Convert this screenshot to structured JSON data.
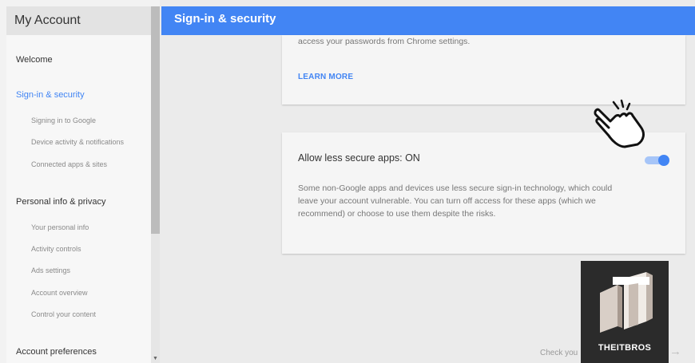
{
  "sidebar": {
    "title": "My Account",
    "items": [
      {
        "label": "Welcome"
      },
      {
        "label": "Sign-in & security",
        "active": true
      },
      {
        "label": "Signing in to Google"
      },
      {
        "label": "Device activity & notifications"
      },
      {
        "label": "Connected apps & sites"
      },
      {
        "label": "Personal info & privacy"
      },
      {
        "label": "Your personal info"
      },
      {
        "label": "Activity controls"
      },
      {
        "label": "Ads settings"
      },
      {
        "label": "Account overview"
      },
      {
        "label": "Control your content"
      },
      {
        "label": "Account preferences"
      }
    ]
  },
  "header": {
    "title": "Sign-in & security"
  },
  "main": {
    "card1": {
      "text": "access your passwords from Chrome settings.",
      "link": "LEARN MORE"
    },
    "card2": {
      "title": "Allow less secure apps: ON",
      "toggle_on": true,
      "description": "Some non-Google apps and devices use less secure sign-in technology, which could leave your account vulnerable. You can turn off access for these apps (which we recommend) or choose to use them despite the risks."
    },
    "footer_link": "Check you",
    "footer_arrow": "→"
  },
  "logo": {
    "text": "THEITBROS"
  },
  "colors": {
    "accent": "#4285f4",
    "sidebar_bg": "#f7f7f7",
    "main_bg": "#ebebeb"
  },
  "icons": {
    "cursor": "hand-pointer-icon",
    "logo": "theitbros-logo-icon"
  }
}
